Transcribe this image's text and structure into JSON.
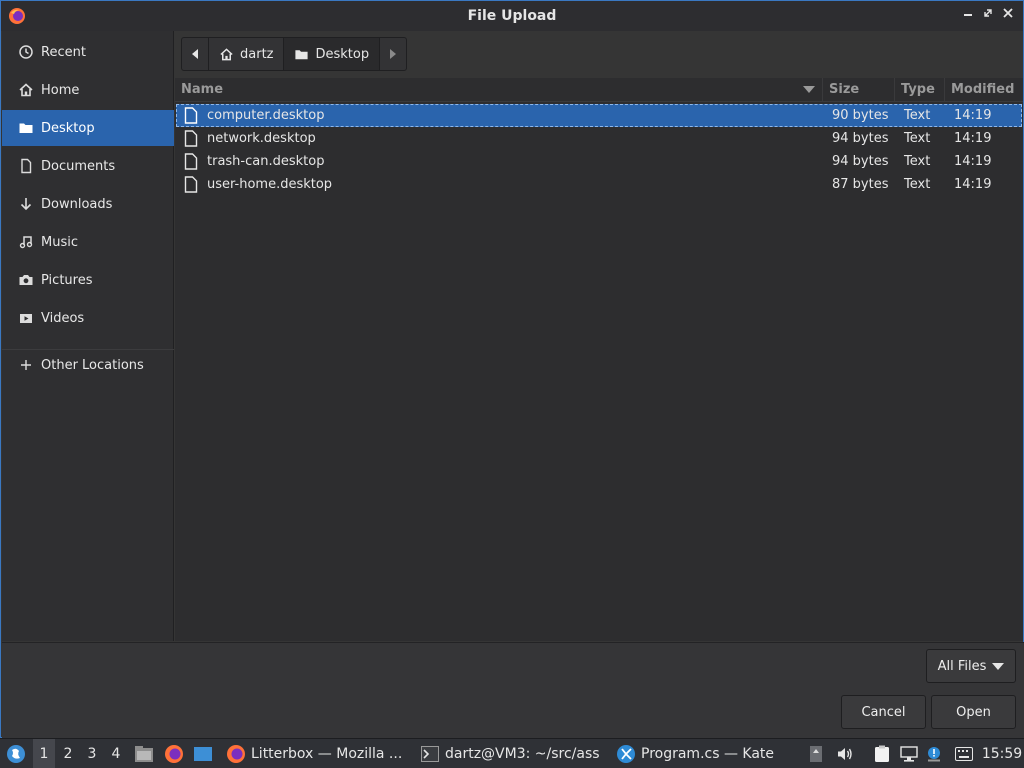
{
  "window": {
    "title": "File Upload",
    "controls": {
      "minimize": "minimize-icon",
      "restore": "restore-icon",
      "close": "close-icon"
    }
  },
  "sidebar": {
    "items": [
      {
        "label": "Recent",
        "icon": "clock-icon"
      },
      {
        "label": "Home",
        "icon": "home-icon"
      },
      {
        "label": "Desktop",
        "icon": "folder-icon",
        "active": true
      },
      {
        "label": "Documents",
        "icon": "document-icon"
      },
      {
        "label": "Downloads",
        "icon": "download-icon"
      },
      {
        "label": "Music",
        "icon": "music-icon"
      },
      {
        "label": "Pictures",
        "icon": "camera-icon"
      },
      {
        "label": "Videos",
        "icon": "video-icon"
      },
      {
        "label": "Other Locations",
        "icon": "plus-icon"
      }
    ]
  },
  "pathbar": {
    "segments": [
      {
        "label": "dartz",
        "icon": "home-icon"
      },
      {
        "label": "Desktop",
        "icon": "folder-icon",
        "active": true
      }
    ]
  },
  "filelist": {
    "columns": {
      "name": "Name",
      "size": "Size",
      "type": "Type",
      "modified": "Modified"
    },
    "rows": [
      {
        "name": "computer.desktop",
        "size": "90 bytes",
        "type": "Text",
        "modified": "14:19",
        "selected": true
      },
      {
        "name": "network.desktop",
        "size": "94 bytes",
        "type": "Text",
        "modified": "14:19"
      },
      {
        "name": "trash-can.desktop",
        "size": "94 bytes",
        "type": "Text",
        "modified": "14:19"
      },
      {
        "name": "user-home.desktop",
        "size": "87 bytes",
        "type": "Text",
        "modified": "14:19"
      }
    ]
  },
  "filter": {
    "selected": "All Files"
  },
  "actions": {
    "cancel": "Cancel",
    "open": "Open"
  },
  "taskbar": {
    "workspaces": [
      "1",
      "2",
      "3",
      "4"
    ],
    "active_workspace": "1",
    "tasks": [
      {
        "label": "Litterbox — Mozilla ...",
        "icon": "firefox-icon"
      },
      {
        "label": "dartz@VM3: ~/src/ass",
        "icon": "terminal-icon"
      },
      {
        "label": "Program.cs — Kate",
        "icon": "kate-icon"
      }
    ],
    "clock": "15:59"
  },
  "colors": {
    "accent": "#2a64ad",
    "window_bg": "#353535",
    "list_bg": "#2d2d2f",
    "taskbar_bg": "#2f3136"
  }
}
